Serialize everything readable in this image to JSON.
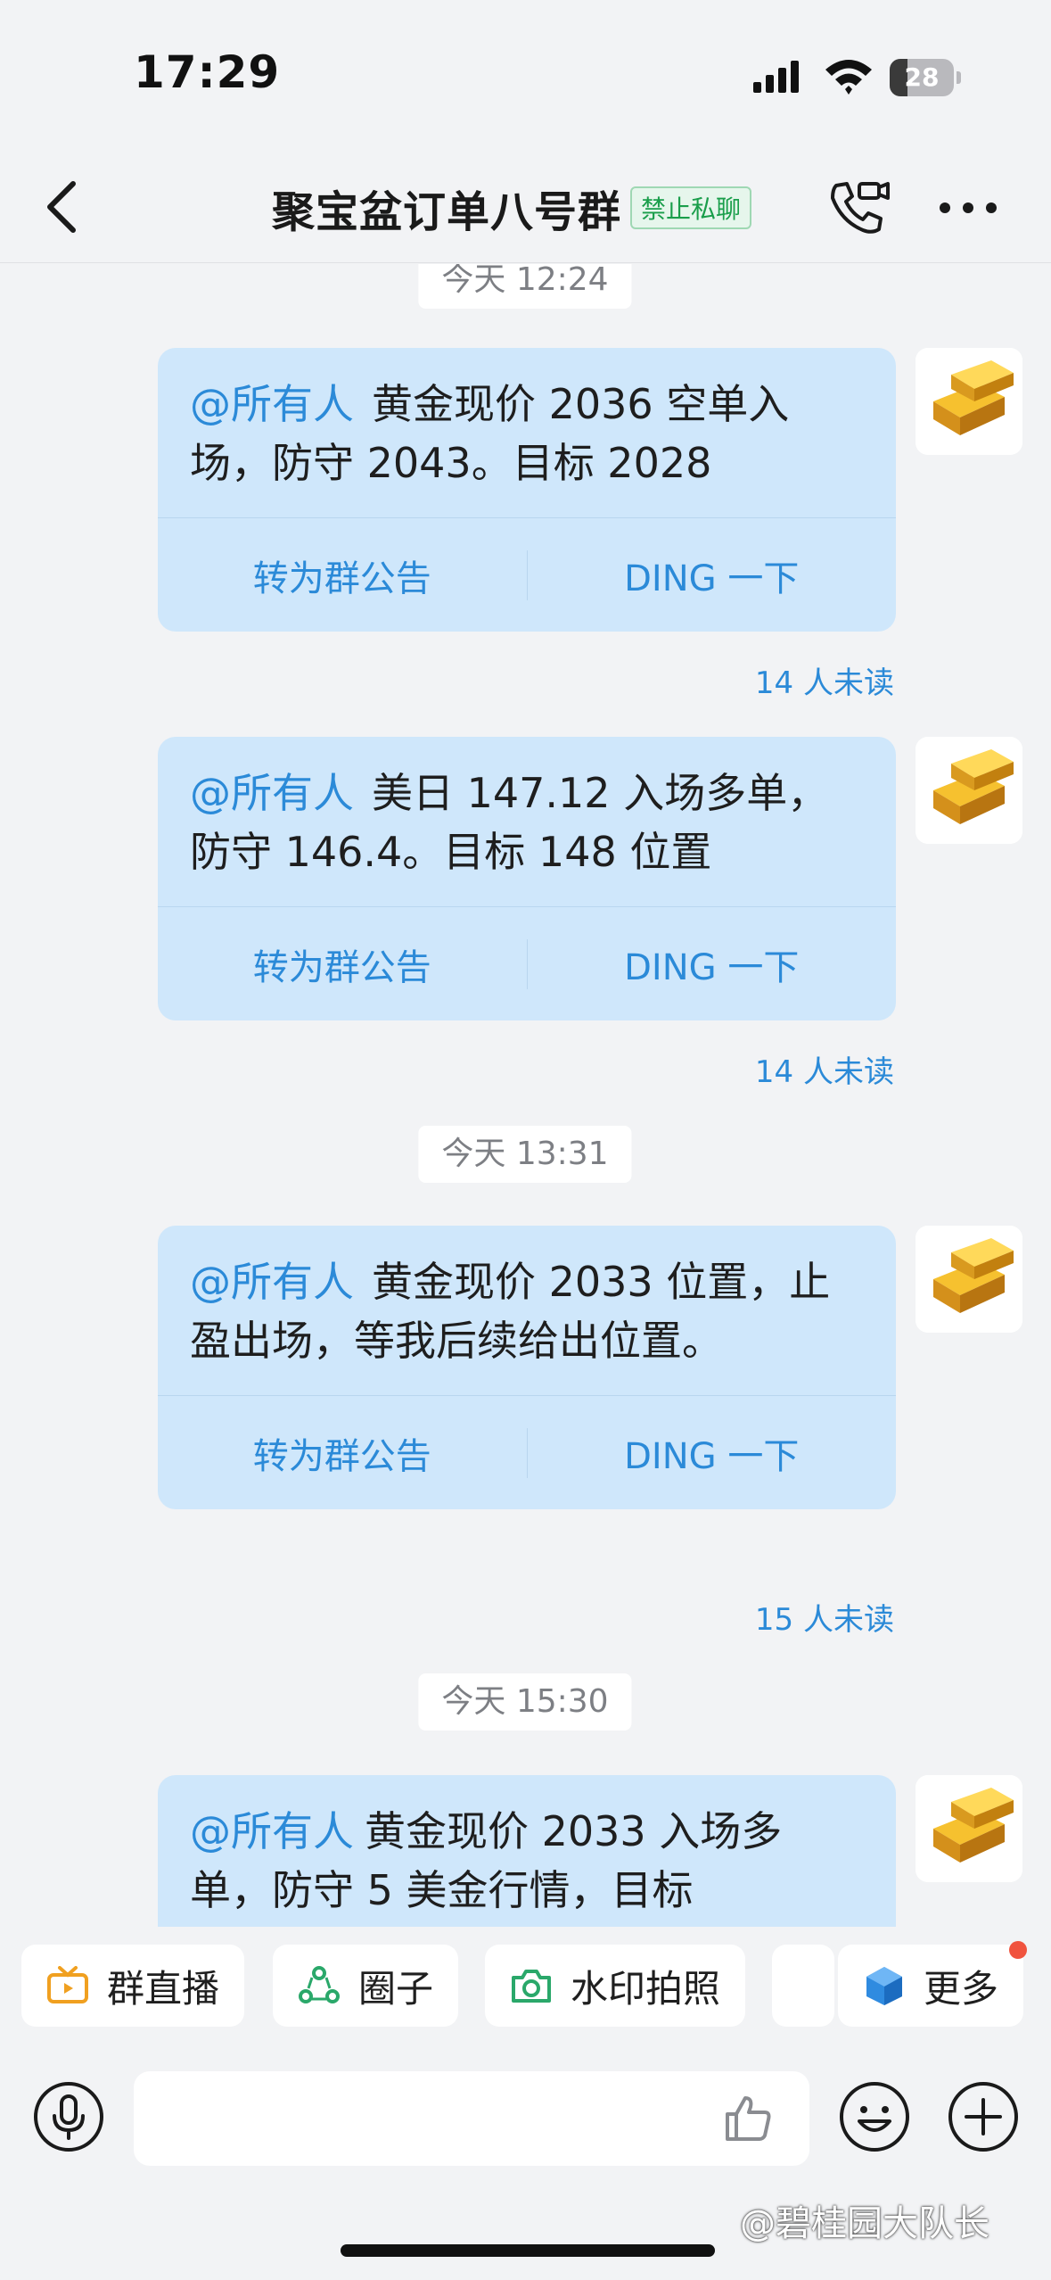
{
  "status_bar": {
    "time": "17:29",
    "battery": "28",
    "battery_level": 0.28
  },
  "nav": {
    "title": "聚宝盆订单八号群",
    "badge": "禁止私聊"
  },
  "messages": [
    {
      "mention": "@所有人",
      "text": "黄金现价 2036 空单入场，防守 2043。目标 2028",
      "action_announce": "转为群公告",
      "action_ding": "DING 一下",
      "unread": "14 人未读"
    },
    {
      "mention": "@所有人",
      "text": "美日 147.12 入场多单，防守 146.4。目标 148 位置",
      "action_announce": "转为群公告",
      "action_ding": "DING 一下",
      "unread": "14 人未读"
    },
    {
      "mention": "@所有人",
      "text": "黄金现价 2033 位置，止盈出场，等我后续给出位置。",
      "action_announce": "转为群公告",
      "action_ding": "DING 一下",
      "unread": "15 人未读"
    },
    {
      "mention": "@所有人",
      "text": "黄金现价 2033 入场多单，防守 5 美金行情，目标"
    }
  ],
  "time_labels": [
    "今天 12:24",
    "今天 13:31",
    "今天 15:30"
  ],
  "shortcuts": [
    {
      "label": "群直播",
      "icon": "live-tv-icon"
    },
    {
      "label": "圈子",
      "icon": "circle-icon"
    },
    {
      "label": "水印拍照",
      "icon": "camera-icon"
    },
    {
      "label": "更多",
      "icon": "cube-icon"
    }
  ],
  "watermark": "@碧桂园大队长",
  "colors": {
    "accent": "#2b8ad8",
    "bubble": "#cfe7fb",
    "badge_green": "#1a9e4b",
    "notify_dot": "#f0533e"
  }
}
